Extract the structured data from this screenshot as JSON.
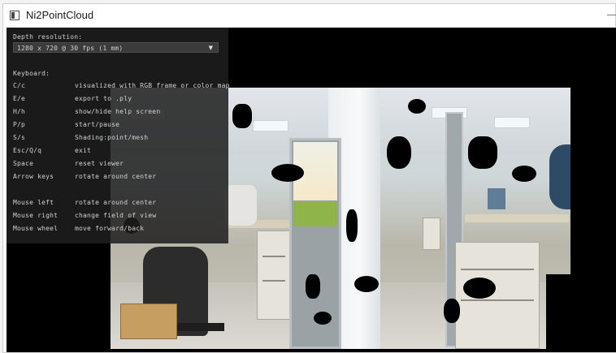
{
  "window": {
    "title": "Ni2PointCloud",
    "minimize": "—"
  },
  "depth": {
    "label": "Depth resolution:",
    "selected": "1280 x 720 @ 30 fps (1 mm)"
  },
  "help": {
    "keyboard_title": "Keyboard:",
    "keyboard": [
      {
        "key": "C/c",
        "desc": "visualized with RGB frame or color map"
      },
      {
        "key": "E/e",
        "desc": "export to .ply"
      },
      {
        "key": "H/h",
        "desc": "show/hide help screen"
      },
      {
        "key": "P/p",
        "desc": "start/pause"
      },
      {
        "key": "S/s",
        "desc": "Shading:point/mesh"
      },
      {
        "key": "Esc/Q/q",
        "desc": "exit"
      },
      {
        "key": "Space",
        "desc": "reset viewer"
      },
      {
        "key": "Arrow keys",
        "desc": "rotate around center"
      }
    ],
    "mouse": [
      {
        "key": "Mouse left",
        "desc": "rotate around center"
      },
      {
        "key": "Mouse right",
        "desc": "change field of view"
      },
      {
        "key": "Mouse wheel",
        "desc": "move forward/back"
      }
    ]
  },
  "colors": {
    "overlay": "#1e1e1e",
    "viewport": "#000000",
    "accent_green": "#8fb44a"
  }
}
